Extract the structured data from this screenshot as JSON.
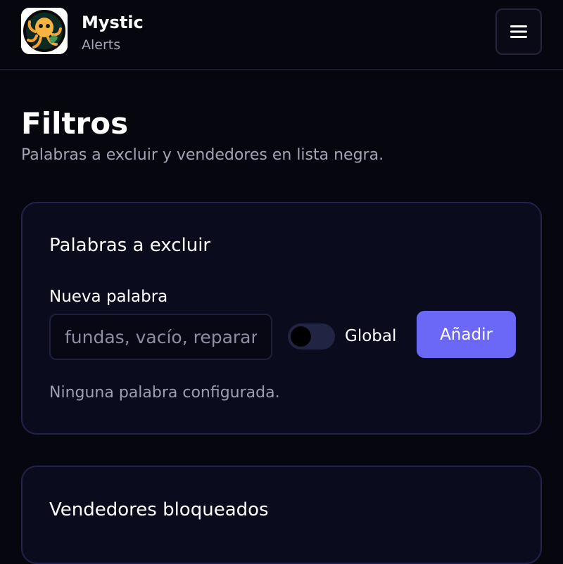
{
  "header": {
    "logo_icon": "octopus-logo-icon",
    "brand_name": "Mystic",
    "brand_sub": "Alerts",
    "menu_icon": "hamburger-menu-icon"
  },
  "page": {
    "title": "Filtros",
    "subtitle": "Palabras a excluir y vendedores en lista negra."
  },
  "excluded_words": {
    "title": "Palabras a excluir",
    "field_label": "Nueva palabra",
    "input_value": "",
    "input_placeholder": "fundas, vacío, reparar",
    "global_toggle_label": "Global",
    "global_toggle_on": false,
    "add_button_label": "Añadir",
    "empty_message": "Ninguna palabra configurada."
  },
  "blocked_sellers": {
    "title": "Vendedores bloqueados"
  },
  "colors": {
    "background": "#06060f",
    "card_background": "#0b0b1e",
    "card_border": "#22234a",
    "accent": "#6c68f7",
    "muted_text": "#a3a4b6"
  }
}
